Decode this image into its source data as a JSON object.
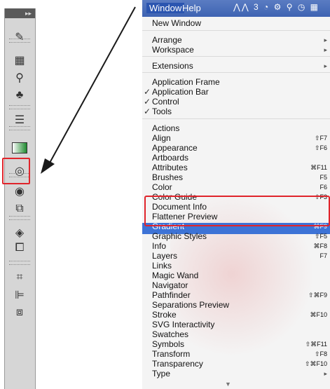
{
  "menubar": {
    "window_label": "Window",
    "help_label": "Help",
    "status_icons": "⋀⋀ 3  ◔  ⚙  ⚲  ◷  ▦"
  },
  "menu": {
    "items": [
      {
        "label": "New Window",
        "shortcut": ""
      },
      {
        "label": "Arrange",
        "submenu": true
      },
      {
        "label": "Workspace",
        "submenu": true
      },
      {
        "label": "Extensions",
        "submenu": true
      },
      {
        "label": "Application Frame"
      },
      {
        "label": "Application Bar",
        "checked": true
      },
      {
        "label": "Control",
        "checked": true
      },
      {
        "label": "Tools",
        "checked": true
      },
      {
        "label": "Actions"
      },
      {
        "label": "Align",
        "shortcut": "⇧F7"
      },
      {
        "label": "Appearance",
        "shortcut": "⇧F6"
      },
      {
        "label": "Artboards"
      },
      {
        "label": "Attributes",
        "shortcut": "⌘F11"
      },
      {
        "label": "Brushes",
        "shortcut": "F5"
      },
      {
        "label": "Color",
        "shortcut": "F6"
      },
      {
        "label": "Color Guide",
        "shortcut": "⇧F3"
      },
      {
        "label": "Document Info"
      },
      {
        "label": "Flattener Preview"
      },
      {
        "label": "Gradient",
        "shortcut": "⌘F9",
        "selected": true
      },
      {
        "label": "Graphic Styles",
        "shortcut": "⇧F5"
      },
      {
        "label": "Info",
        "shortcut": "⌘F8"
      },
      {
        "label": "Layers",
        "shortcut": "F7"
      },
      {
        "label": "Links"
      },
      {
        "label": "Magic Wand"
      },
      {
        "label": "Navigator"
      },
      {
        "label": "Pathfinder",
        "shortcut": "⇧⌘F9"
      },
      {
        "label": "Separations Preview"
      },
      {
        "label": "Stroke",
        "shortcut": "⌘F10"
      },
      {
        "label": "SVG Interactivity"
      },
      {
        "label": "Swatches"
      },
      {
        "label": "Symbols",
        "shortcut": "⇧⌘F11"
      },
      {
        "label": "Transform",
        "shortcut": "⇧F8"
      },
      {
        "label": "Transparency",
        "shortcut": "⇧⌘F10"
      },
      {
        "label": "Type",
        "submenu": true
      }
    ],
    "submenu_glyph": "▸",
    "check_glyph": "✓",
    "scroll_glyph": "▼"
  },
  "tool_panel": {
    "collapse_glyph": "▸▸",
    "tools": [
      {
        "name": "symbol-sprayer-icon",
        "glyph": "✎"
      },
      {
        "name": "grid-icon",
        "glyph": "▦"
      },
      {
        "name": "puppet-icon",
        "glyph": "⚲"
      },
      {
        "name": "club-icon",
        "glyph": "♣"
      },
      {
        "name": "stroke-lines-icon",
        "glyph": "☰"
      },
      {
        "name": "gradient-icon",
        "glyph": ""
      },
      {
        "name": "transparency-icon",
        "glyph": "◎"
      },
      {
        "name": "appearance-icon",
        "glyph": "◉"
      },
      {
        "name": "graphic-styles-icon",
        "glyph": "⧉"
      },
      {
        "name": "layers-icon",
        "glyph": "◈"
      },
      {
        "name": "artboards-icon",
        "glyph": "⧠"
      },
      {
        "name": "transform-icon",
        "glyph": "⌗"
      },
      {
        "name": "align-icon",
        "glyph": "⊫"
      },
      {
        "name": "pathfinder-icon",
        "glyph": "⧈"
      }
    ]
  },
  "colors": {
    "highlight_red": "#e0242b",
    "selection_blue": "#3d73d6",
    "menubar_blue": "#4a6fbb"
  }
}
